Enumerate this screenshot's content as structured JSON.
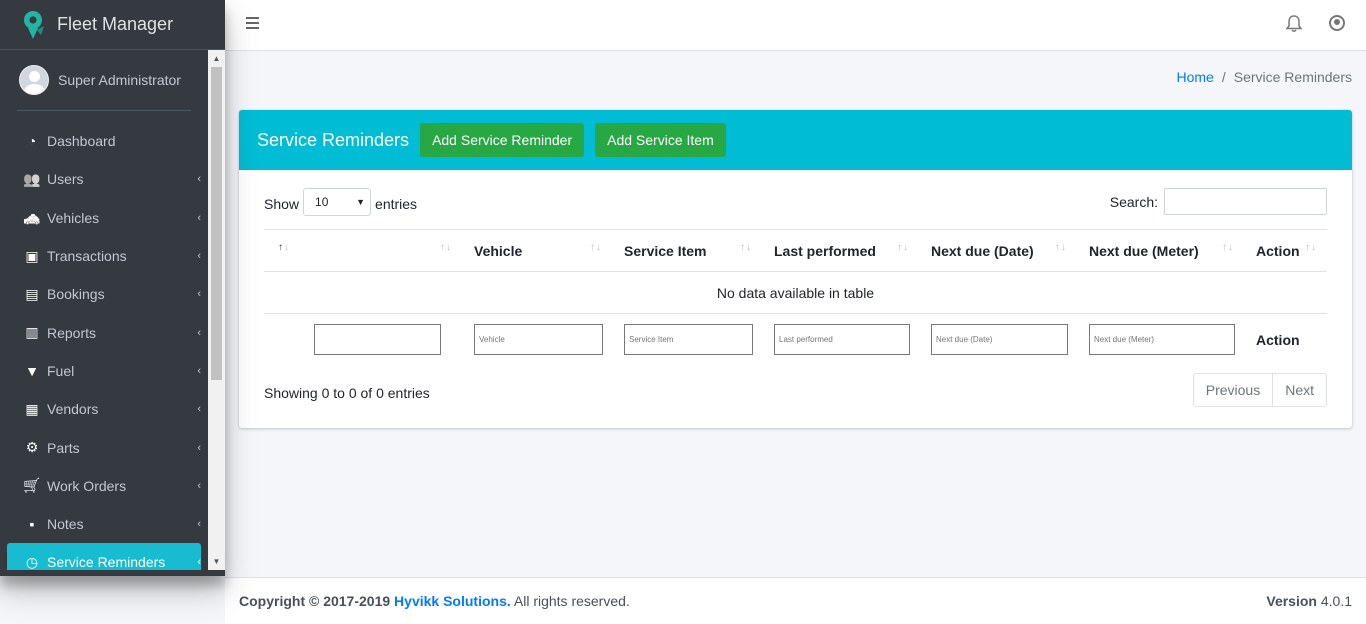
{
  "app": {
    "title": "Fleet Manager"
  },
  "user": {
    "name": "Super Administrator"
  },
  "sidebar": {
    "items": [
      {
        "label": "Dashboard",
        "icon": "tachometer-icon",
        "chevron": ""
      },
      {
        "label": "Users",
        "icon": "users-icon",
        "chevron": "‹"
      },
      {
        "label": "Vehicles",
        "icon": "taxi-icon",
        "chevron": "‹"
      },
      {
        "label": "Transactions",
        "icon": "money-icon",
        "chevron": "‹"
      },
      {
        "label": "Bookings",
        "icon": "address-card-icon",
        "chevron": "‹"
      },
      {
        "label": "Reports",
        "icon": "book-icon",
        "chevron": "‹"
      },
      {
        "label": "Fuel",
        "icon": "filter-icon",
        "chevron": "‹"
      },
      {
        "label": "Vendors",
        "icon": "cubes-icon",
        "chevron": "‹"
      },
      {
        "label": "Parts",
        "icon": "gears-icon",
        "chevron": "‹"
      },
      {
        "label": "Work Orders",
        "icon": "cart-icon",
        "chevron": "‹"
      },
      {
        "label": "Notes",
        "icon": "sticky-note-icon",
        "chevron": "‹"
      },
      {
        "label": "Service Reminders",
        "icon": "clock-icon",
        "chevron": "‹",
        "active": true
      }
    ]
  },
  "breadcrumb": {
    "home": "Home",
    "separator": "/",
    "current": "Service Reminders"
  },
  "card": {
    "title": "Service Reminders",
    "add_reminder_label": "Add Service Reminder",
    "add_item_label": "Add Service Item"
  },
  "table": {
    "show_label": "Show",
    "entries_label": "entries",
    "page_size": "10",
    "search_label": "Search:",
    "columns": [
      "",
      "Vehicle",
      "Service Item",
      "Last performed",
      "Next due (Date)",
      "Next due (Meter)",
      "Action"
    ],
    "empty_message": "No data available in table",
    "filters": {
      "vehicle": "Vehicle",
      "service_item": "Service Item",
      "last_performed": "Last performed",
      "next_due_date": "Next due (Date)",
      "next_due_meter": "Next due (Meter)",
      "action": "Action"
    },
    "info": "Showing 0 to 0 of 0 entries",
    "pager": {
      "previous": "Previous",
      "next": "Next"
    }
  },
  "footer": {
    "copyright": "Copyright © 2017-2019 ",
    "company": "Hyvikk Solutions.",
    "rights": " All rights reserved.",
    "version_label": "Version",
    "version": "4.0.1"
  },
  "colors": {
    "accent": "#00bcd4",
    "sidebar": "#343a40",
    "success": "#28a745",
    "link": "#007bff"
  }
}
